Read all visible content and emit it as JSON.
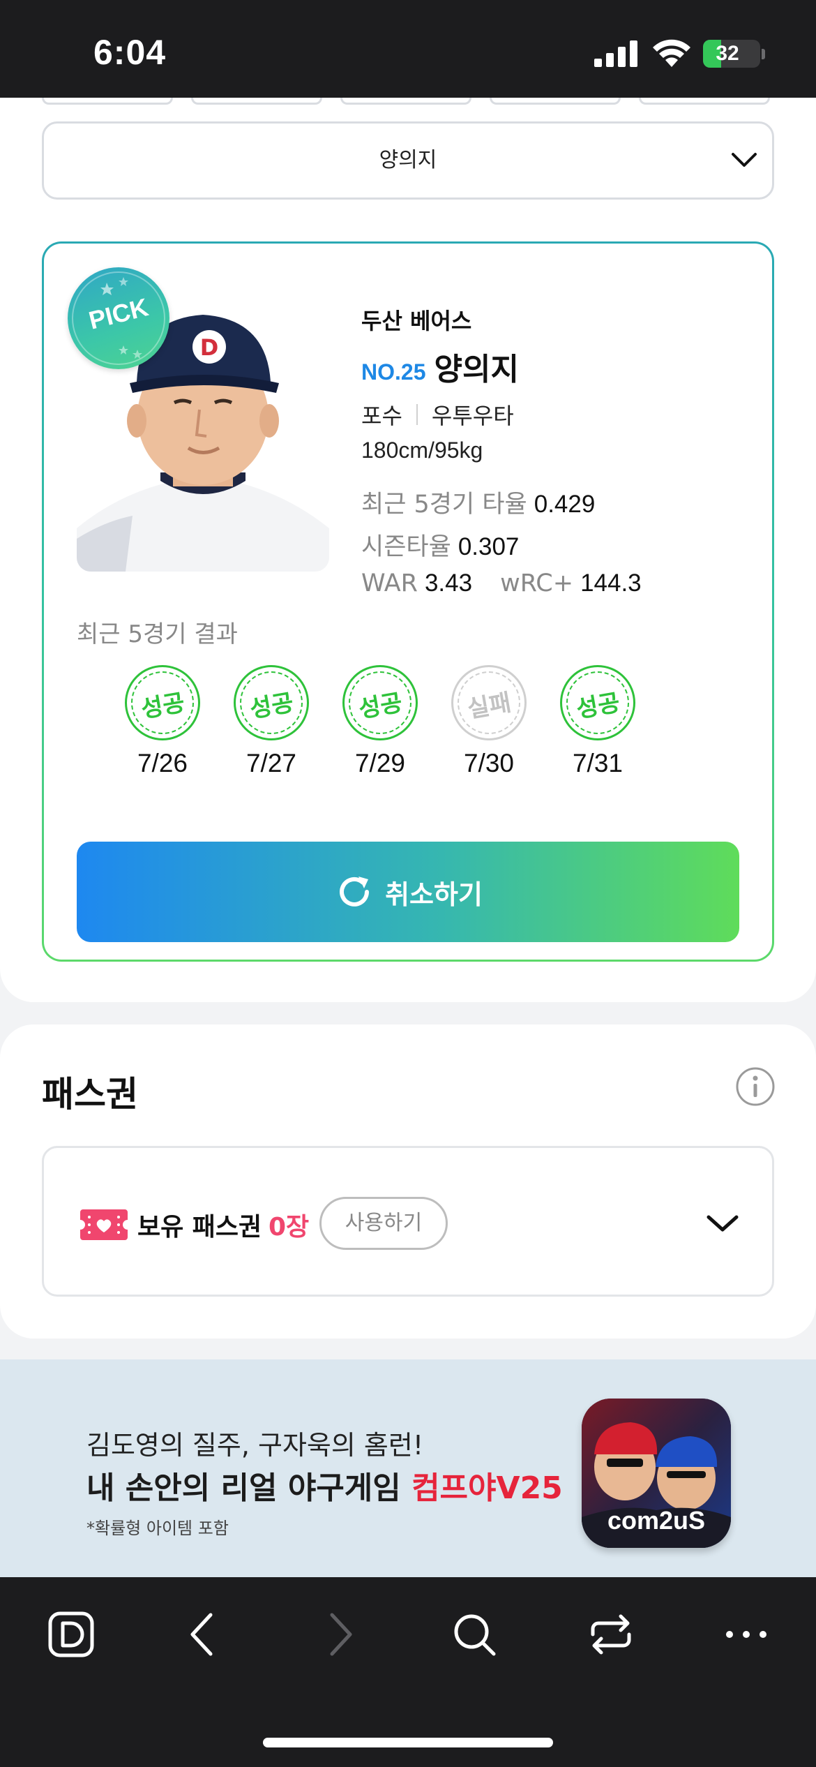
{
  "status_bar": {
    "time": "6:04",
    "battery": "32",
    "battery_level": 0.32
  },
  "player_select": {
    "value": "양의지"
  },
  "player_card": {
    "badge": "PICK",
    "team": "두산 베어스",
    "number": "NO.25",
    "name": "양의지",
    "position": "포수",
    "handedness": "우투우타",
    "body": "180cm/95kg",
    "stats": {
      "recent5_label": "최근 5경기 타율",
      "recent5_value": "0.429",
      "season_label": "시즌타율",
      "season_value": "0.307",
      "war_label": "WAR",
      "war_value": "3.43",
      "wrc_label": "wRC+",
      "wrc_value": "144.3"
    },
    "recent_title": "최근 5경기 결과",
    "results": [
      {
        "label": "성공",
        "date": "7/26",
        "status": "success"
      },
      {
        "label": "성공",
        "date": "7/27",
        "status": "success"
      },
      {
        "label": "성공",
        "date": "7/29",
        "status": "success"
      },
      {
        "label": "실패",
        "date": "7/30",
        "status": "fail"
      },
      {
        "label": "성공",
        "date": "7/31",
        "status": "success"
      }
    ],
    "cancel_button": "취소하기"
  },
  "pass": {
    "title": "패스권",
    "label": "보유 패스권",
    "count": "0장",
    "use_button": "사용하기"
  },
  "ad": {
    "line1": "김도영의 질주, 구자욱의 홈런!",
    "line2_main": "내 손안의 리얼 야구게임 ",
    "line2_accent": "컴프야V25",
    "note": "*확률형 아이템 포함",
    "app_label": "com2uS"
  },
  "colors": {
    "accent_blue": "#1e88e5",
    "success_green": "#2ec23a",
    "pass_count_pink": "#f0466e",
    "ad_red": "#e6243b"
  }
}
